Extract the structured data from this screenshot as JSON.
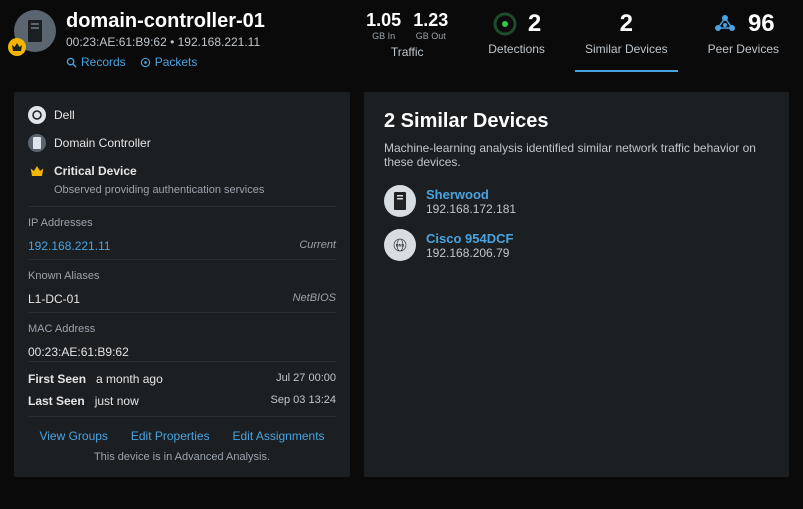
{
  "device": {
    "name": "domain-controller-01",
    "mac": "00:23:AE:61:B9:62",
    "ip": "192.168.221.11",
    "subline": "00:23:AE:61:B9:62  •  192.168.221.11"
  },
  "header_links": {
    "records": "Records",
    "packets": "Packets"
  },
  "metrics": {
    "traffic": {
      "in_value": "1.05",
      "in_unit": "GB In",
      "out_value": "1.23",
      "out_unit": "GB Out",
      "label": "Traffic"
    },
    "detections": {
      "value": "2",
      "label": "Detections"
    },
    "similar": {
      "value": "2",
      "label": "Similar Devices"
    },
    "peer": {
      "value": "96",
      "label": "Peer Devices"
    }
  },
  "details": {
    "vendor": "Dell",
    "role": "Domain Controller",
    "critical_label": "Critical Device",
    "critical_desc": "Observed providing authentication services",
    "ip_section": "IP Addresses",
    "ip_value": "192.168.221.11",
    "ip_tag": "Current",
    "alias_section": "Known Aliases",
    "alias_value": "L1-DC-01",
    "alias_tag": "NetBIOS",
    "mac_section": "MAC Address",
    "mac_value": "00:23:AE:61:B9:62",
    "first_seen_label": "First Seen",
    "first_seen_value": "a month ago",
    "first_seen_ts": "Jul 27 00:00",
    "last_seen_label": "Last Seen",
    "last_seen_value": "just now",
    "last_seen_ts": "Sep 03 13:24"
  },
  "actions": {
    "groups": "View Groups",
    "edit_props": "Edit Properties",
    "edit_assign": "Edit Assignments",
    "footnote": "This device is in Advanced Analysis."
  },
  "similar_panel": {
    "title": "2 Similar Devices",
    "desc": "Machine-learning analysis identified similar network traffic behavior on these devices.",
    "devices": [
      {
        "name": "Sherwood",
        "ip": "192.168.172.181"
      },
      {
        "name": "Cisco 954DCF",
        "ip": "192.168.206.79"
      }
    ]
  }
}
